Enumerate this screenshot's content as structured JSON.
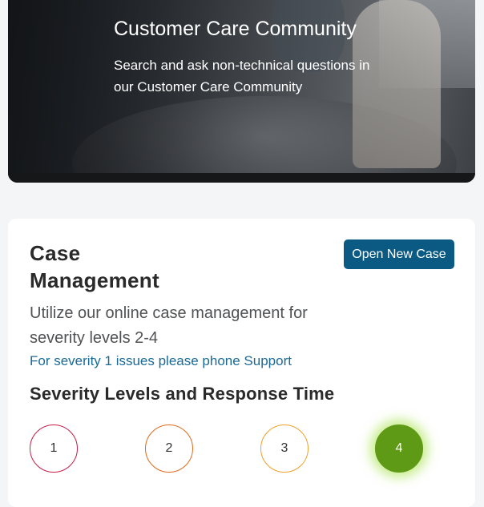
{
  "hero": {
    "title": "Customer Care Community",
    "description": "Search and ask non-technical questions in our Customer Care Community"
  },
  "case_management": {
    "title": "Case Management",
    "open_button_label": "Open New Case",
    "description": "Utilize our online case management for severity levels 2-4",
    "phone_link": "For severity 1 issues please phone Support",
    "severity_title": "Severity Levels and Response Time",
    "severity_levels": [
      {
        "label": "1",
        "color": "#c41f48"
      },
      {
        "label": "2",
        "color": "#e06a1e"
      },
      {
        "label": "3",
        "color": "#efa02a"
      },
      {
        "label": "4",
        "color": "#5f9a16",
        "selected": true
      }
    ]
  },
  "colors": {
    "accent": "#0b5a84",
    "link": "#1a6a96",
    "page_background": "#f4f5f7"
  }
}
